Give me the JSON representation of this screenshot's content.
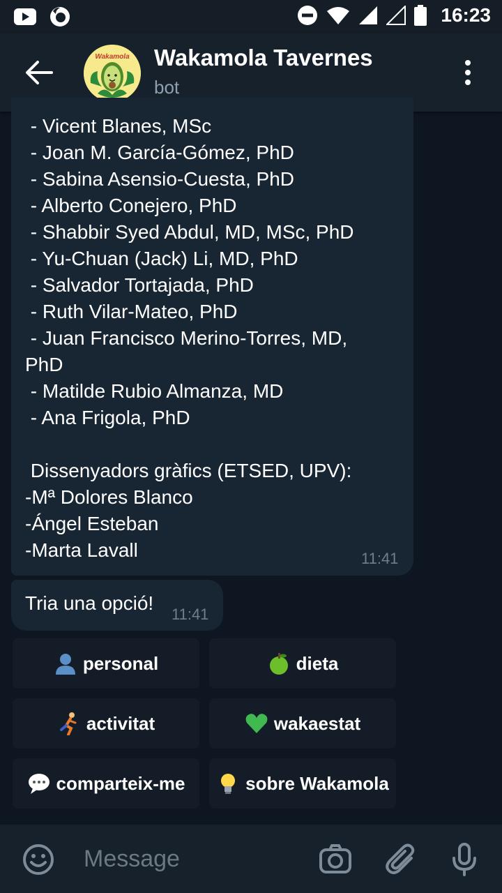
{
  "status_bar": {
    "time": "16:23"
  },
  "header": {
    "title": "Wakamola Tavernes",
    "subtitle": "bot",
    "avatar_text": "Wakamola"
  },
  "messages": [
    {
      "lines": [
        " - Vicent Blanes, MSc",
        " - Joan M. García-Gómez, PhD",
        " - Sabina Asensio-Cuesta, PhD",
        " - Alberto Conejero, PhD",
        " - Shabbir Syed Abdul, MD, MSc, PhD",
        " - Yu-Chuan (Jack) Li, MD, PhD",
        " - Salvador Tortajada, PhD",
        " - Ruth Vilar-Mateo, PhD",
        " - Juan Francisco Merino-Torres, MD,",
        "PhD",
        " - Matilde Rubio Almanza, MD",
        " - Ana Frigola, PhD",
        "",
        " Dissenyadors gràfics (ETSED, UPV):",
        "-Mª Dolores Blanco",
        "-Ángel Esteban",
        "-Marta Lavall"
      ],
      "time": "11:41"
    },
    {
      "text": "Tria una opció!",
      "time": "11:41"
    }
  ],
  "keyboard": [
    {
      "emoji": "person-silhouette-icon",
      "label": "personal"
    },
    {
      "emoji": "green-apple-icon",
      "label": "dieta"
    },
    {
      "emoji": "runner-icon",
      "label": "activitat"
    },
    {
      "emoji": "green-heart-icon",
      "label": "wakaestat"
    },
    {
      "emoji": "speech-bubble-icon",
      "label": "comparteix-me"
    },
    {
      "emoji": "light-bulb-icon",
      "label": "sobre Wakamola"
    }
  ],
  "composer": {
    "placeholder": "Message"
  },
  "colors": {
    "background": "#0e1621",
    "header": "#17212b",
    "bubble": "#182533",
    "button": "#141d27",
    "subtitle": "#8da1b3"
  }
}
